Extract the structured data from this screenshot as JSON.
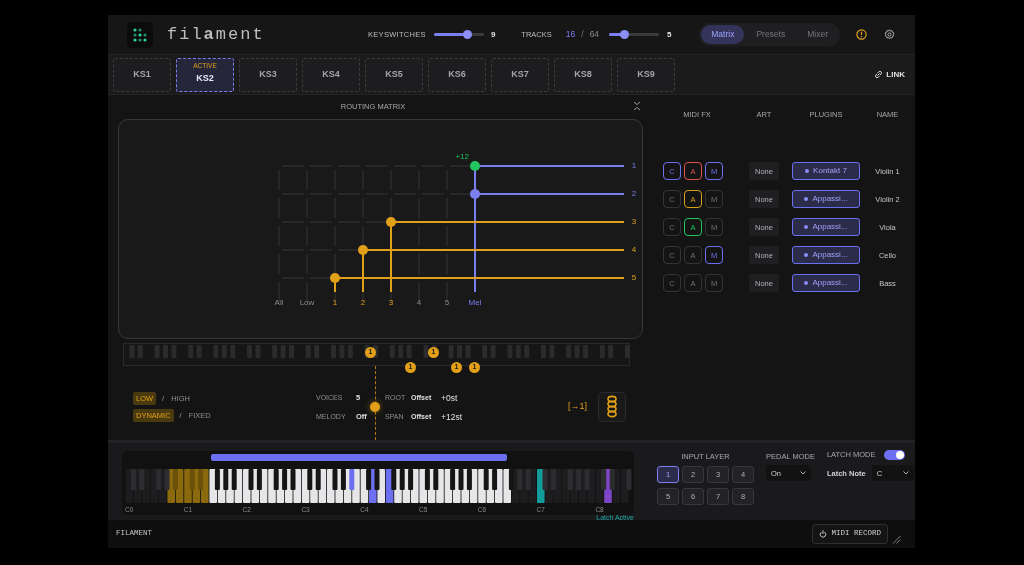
{
  "header": {
    "logo_text": "fil**a**ment",
    "keyswitches": {
      "label": "KEYSWITCHES",
      "level": 0.66,
      "value": "9"
    },
    "tracks": {
      "label": "TRACKS",
      "used": "16",
      "separator": "/",
      "total": "64",
      "level": 0.29,
      "value": "5"
    },
    "views": [
      {
        "label": "Matrix",
        "selected": true
      },
      {
        "label": "Presets",
        "selected": false
      },
      {
        "label": "Mixer",
        "selected": false
      }
    ]
  },
  "keyswitch_tabs": [
    {
      "label": "KS1",
      "selected": false
    },
    {
      "label": "KS2",
      "selected": true,
      "badge": "ACTIVE"
    },
    {
      "label": "KS3",
      "selected": false
    },
    {
      "label": "KS4",
      "selected": false
    },
    {
      "label": "KS5",
      "selected": false
    },
    {
      "label": "KS6",
      "selected": false
    },
    {
      "label": "KS7",
      "selected": false
    },
    {
      "label": "KS8",
      "selected": false
    },
    {
      "label": "KS9",
      "selected": false
    }
  ],
  "link": "LINK",
  "routing": {
    "title": "ROUTING MATRIX",
    "columns": [
      {
        "label": "All",
        "active": false
      },
      {
        "label": "Low",
        "active": false
      },
      {
        "label": "1",
        "active": true
      },
      {
        "label": "2",
        "active": true
      },
      {
        "label": "3",
        "active": true
      },
      {
        "label": "4",
        "active": false
      },
      {
        "label": "5",
        "active": false
      },
      {
        "label": "Mel",
        "active": true
      }
    ],
    "outputs": [
      {
        "label": "1",
        "color": "#7b7ff0",
        "node": {
          "color": "#22c55e",
          "note": "+12"
        }
      },
      {
        "label": "2",
        "color": "#7b7ff0",
        "node": {
          "color": "#7b7ff0"
        }
      },
      {
        "label": "3",
        "color": "#e2a019",
        "node": {
          "color": "#e2a019"
        }
      },
      {
        "label": "4",
        "color": "#e2a019",
        "node": {
          "color": "#e2a019"
        }
      },
      {
        "label": "5",
        "color": "#e2a019",
        "node": {
          "color": "#e2a019"
        }
      }
    ]
  },
  "table": {
    "columns": [
      "MIDI FX",
      "ART",
      "PLUGINS",
      "NAME"
    ],
    "rows": [
      {
        "fx": [
          {
            "label": "C",
            "on": true,
            "color": "#6b6ff0"
          },
          {
            "label": "A",
            "on": true,
            "color": "#e0524a"
          },
          {
            "label": "M",
            "on": true,
            "color": "#6b6ff0"
          }
        ],
        "art": "None",
        "plugin": "Kontakt 7",
        "name": "Violin 1"
      },
      {
        "fx": [
          {
            "label": "C",
            "on": false
          },
          {
            "label": "A",
            "on": true,
            "color": "#d4a017"
          },
          {
            "label": "M",
            "on": false
          }
        ],
        "art": "None",
        "plugin": "Appassi...",
        "name": "Violin 2"
      },
      {
        "fx": [
          {
            "label": "C",
            "on": false
          },
          {
            "label": "A",
            "on": true,
            "color": "#22c55e"
          },
          {
            "label": "M",
            "on": false
          }
        ],
        "art": "None",
        "plugin": "Appassi...",
        "name": "Viola"
      },
      {
        "fx": [
          {
            "label": "C",
            "on": false
          },
          {
            "label": "A",
            "on": false
          },
          {
            "label": "M",
            "on": true,
            "color": "#6b6ff0"
          }
        ],
        "art": "None",
        "plugin": "Appassi...",
        "name": "Cello"
      },
      {
        "fx": [
          {
            "label": "C",
            "on": false
          },
          {
            "label": "A",
            "on": false
          },
          {
            "label": "M",
            "on": false
          }
        ],
        "art": "None",
        "plugin": "Appassi...",
        "name": "Bass"
      }
    ]
  },
  "key_badges": [
    "1",
    "1",
    "1",
    "1",
    "1"
  ],
  "note_priority": {
    "separator": "/",
    "options": [
      {
        "label": "LOW",
        "selected": true
      },
      {
        "label": "HIGH",
        "selected": false
      }
    ]
  },
  "voicing": {
    "separator": "/",
    "options": [
      {
        "label": "DYNAMIC",
        "selected": true
      },
      {
        "label": "FIXED",
        "selected": false
      }
    ]
  },
  "voices": {
    "label": "VOICES",
    "value": "5"
  },
  "melody": {
    "label": "MELODY",
    "value": "Off"
  },
  "root": {
    "label": "ROOT",
    "mode": "Offset",
    "value": "+0st"
  },
  "span": {
    "label": "SPAN",
    "mode": "Offset",
    "value": "+12st"
  },
  "channel_target": "[→1]",
  "keyboard": {
    "octave_labels": [
      "C0",
      "C1",
      "C2",
      "C3",
      "C4",
      "C5",
      "C6",
      "C7",
      "C8"
    ],
    "status": "Latch Active"
  },
  "input_layer": {
    "label": "INPUT LAYER",
    "layers": [
      {
        "label": "1",
        "selected": true
      },
      {
        "label": "2",
        "selected": false
      },
      {
        "label": "3",
        "selected": false
      },
      {
        "label": "4",
        "selected": false
      },
      {
        "label": "5",
        "selected": false
      },
      {
        "label": "6",
        "selected": false
      },
      {
        "label": "7",
        "selected": false
      },
      {
        "label": "8",
        "selected": false
      }
    ]
  },
  "pedal_mode": {
    "label": "PEDAL MODE",
    "value": "On"
  },
  "latch_mode": {
    "label": "LATCH MODE",
    "on": true
  },
  "latch_note": {
    "label": "Latch Note",
    "value": "C"
  },
  "footer": {
    "title": "FILAMENT",
    "record_button": "MIDI RECORD"
  }
}
